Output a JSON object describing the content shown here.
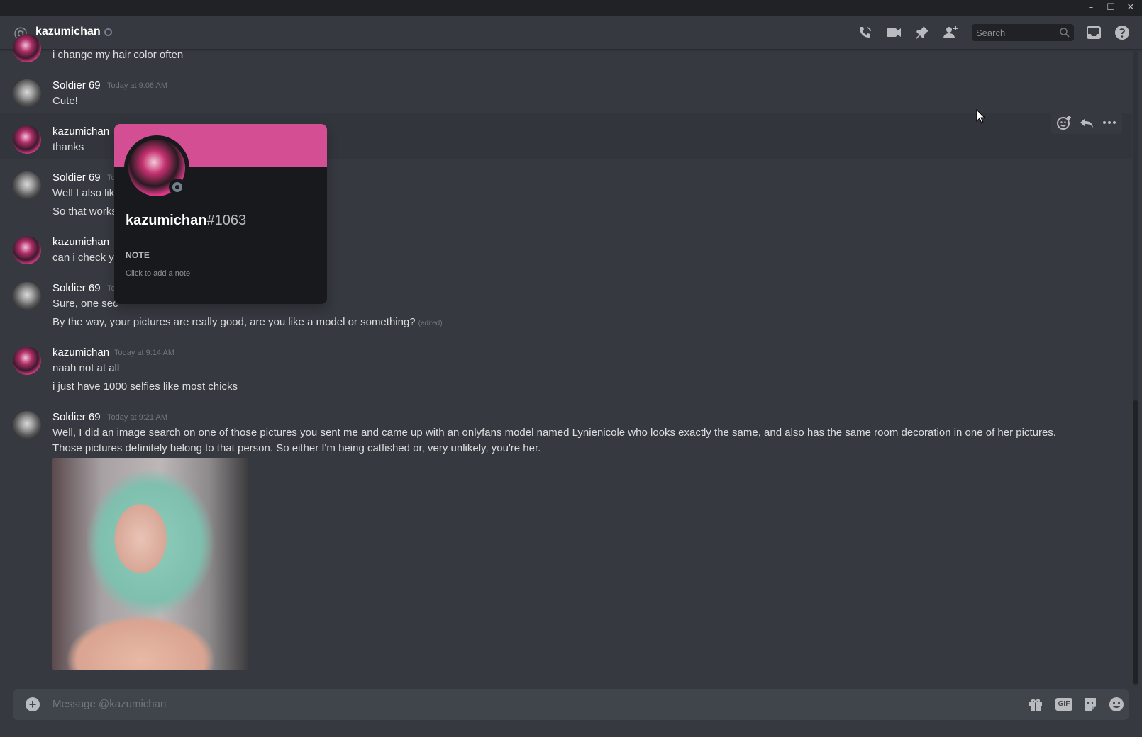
{
  "window": {
    "minimize": "–",
    "maximize": "☐",
    "close": "✕"
  },
  "header": {
    "at_symbol": "@",
    "title": "kazumichan",
    "search_placeholder": "Search",
    "icons": [
      "start-voice-call-icon",
      "start-video-call-icon",
      "pinned-messages-icon",
      "add-friends-icon",
      "search-icon",
      "inbox-icon",
      "help-icon"
    ]
  },
  "messages": [
    {
      "text": "i change my hair color often"
    },
    {
      "author": "Soldier 69",
      "timestamp": "Today at 9:06 AM",
      "lines": [
        "Cute!"
      ]
    },
    {
      "author": "kazumichan",
      "lines": [
        "thanks"
      ]
    },
    {
      "author": "Soldier 69",
      "timestamp": "To",
      "lines": [
        "Well I also lik",
        "So that works"
      ]
    },
    {
      "author": "kazumichan",
      "lines": [
        "can i check yo"
      ]
    },
    {
      "author": "Soldier 69",
      "timestamp": "To",
      "lines": [
        "Sure, one sec",
        "By the way, your pictures are really good, are you like a model or something?"
      ],
      "edited": "(edited)"
    },
    {
      "author": "kazumichan",
      "timestamp": "Today at 9:14 AM",
      "lines": [
        "naah not at all",
        "i just have 1000 selfies like most chicks"
      ]
    },
    {
      "author": "Soldier 69",
      "timestamp": "Today at 9:21 AM",
      "lines": [
        "Well, I did an image search on one of those pictures you sent me and came up with an onlyfans model named Lynienicole who looks exactly the same, and also has the same room decoration in one of her pictures. Those pictures definitely belong to that person. So either I'm being catfished or, very unlikely, you're her."
      ]
    }
  ],
  "message_tools": [
    "add-reaction-icon",
    "reply-icon",
    "more-icon"
  ],
  "popout": {
    "username": "kazumichan",
    "discriminator": "#1063",
    "note_label": "NOTE",
    "note_placeholder": "Click to add a note"
  },
  "composer": {
    "placeholder": "Message @kazumichan",
    "gif_label": "GIF"
  },
  "colors": {
    "banner": "#d34e92",
    "background": "#36393f",
    "composer": "#40444b",
    "popout": "#18191c"
  }
}
